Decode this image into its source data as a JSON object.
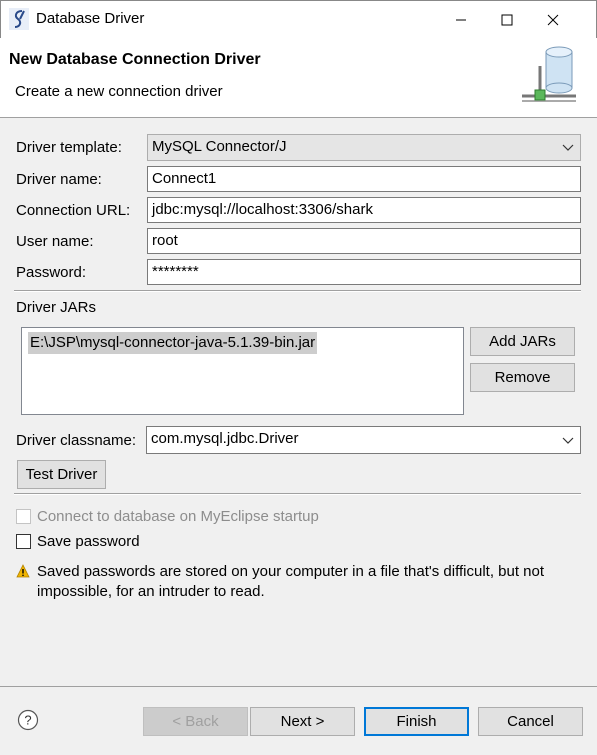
{
  "window": {
    "title": "Database Driver",
    "minimize_icon": "minimize-icon",
    "maximize_icon": "maximize-icon",
    "close_icon": "close-icon"
  },
  "header": {
    "title": "New Database Connection Driver",
    "description": "Create a new connection driver"
  },
  "form": {
    "driver_template_label": "Driver template:",
    "driver_template_value": "MySQL Connector/J",
    "driver_name_label": "Driver name:",
    "driver_name_value": "Connect1",
    "connection_url_label": "Connection URL:",
    "connection_url_value": "jdbc:mysql://localhost:3306/shark",
    "user_name_label": "User name:",
    "user_name_value": "root",
    "password_label": "Password:",
    "password_value": "********"
  },
  "jars": {
    "section_label": "Driver JARs",
    "items": [
      "E:\\JSP\\mysql-connector-java-5.1.39-bin.jar"
    ],
    "add_label": "Add JARs",
    "remove_label": "Remove"
  },
  "classname": {
    "label": "Driver classname:",
    "value": "com.mysql.jdbc.Driver"
  },
  "test_driver_label": "Test Driver",
  "options": {
    "connect_on_startup_label": "Connect to database on MyEclipse startup",
    "connect_on_startup_checked": false,
    "connect_on_startup_enabled": false,
    "save_password_label": "Save password",
    "save_password_checked": false
  },
  "warning": {
    "icon": "warning-icon",
    "text": "Saved passwords are stored on your computer in a file that's difficult, but not impossible, for an intruder to read."
  },
  "footer": {
    "help_icon": "help-icon",
    "back_label": "< Back",
    "next_label": "Next >",
    "finish_label": "Finish",
    "cancel_label": "Cancel"
  },
  "colors": {
    "accent": "#0078d7",
    "selection": "#cdcdcd",
    "warning": "#f0b400"
  }
}
